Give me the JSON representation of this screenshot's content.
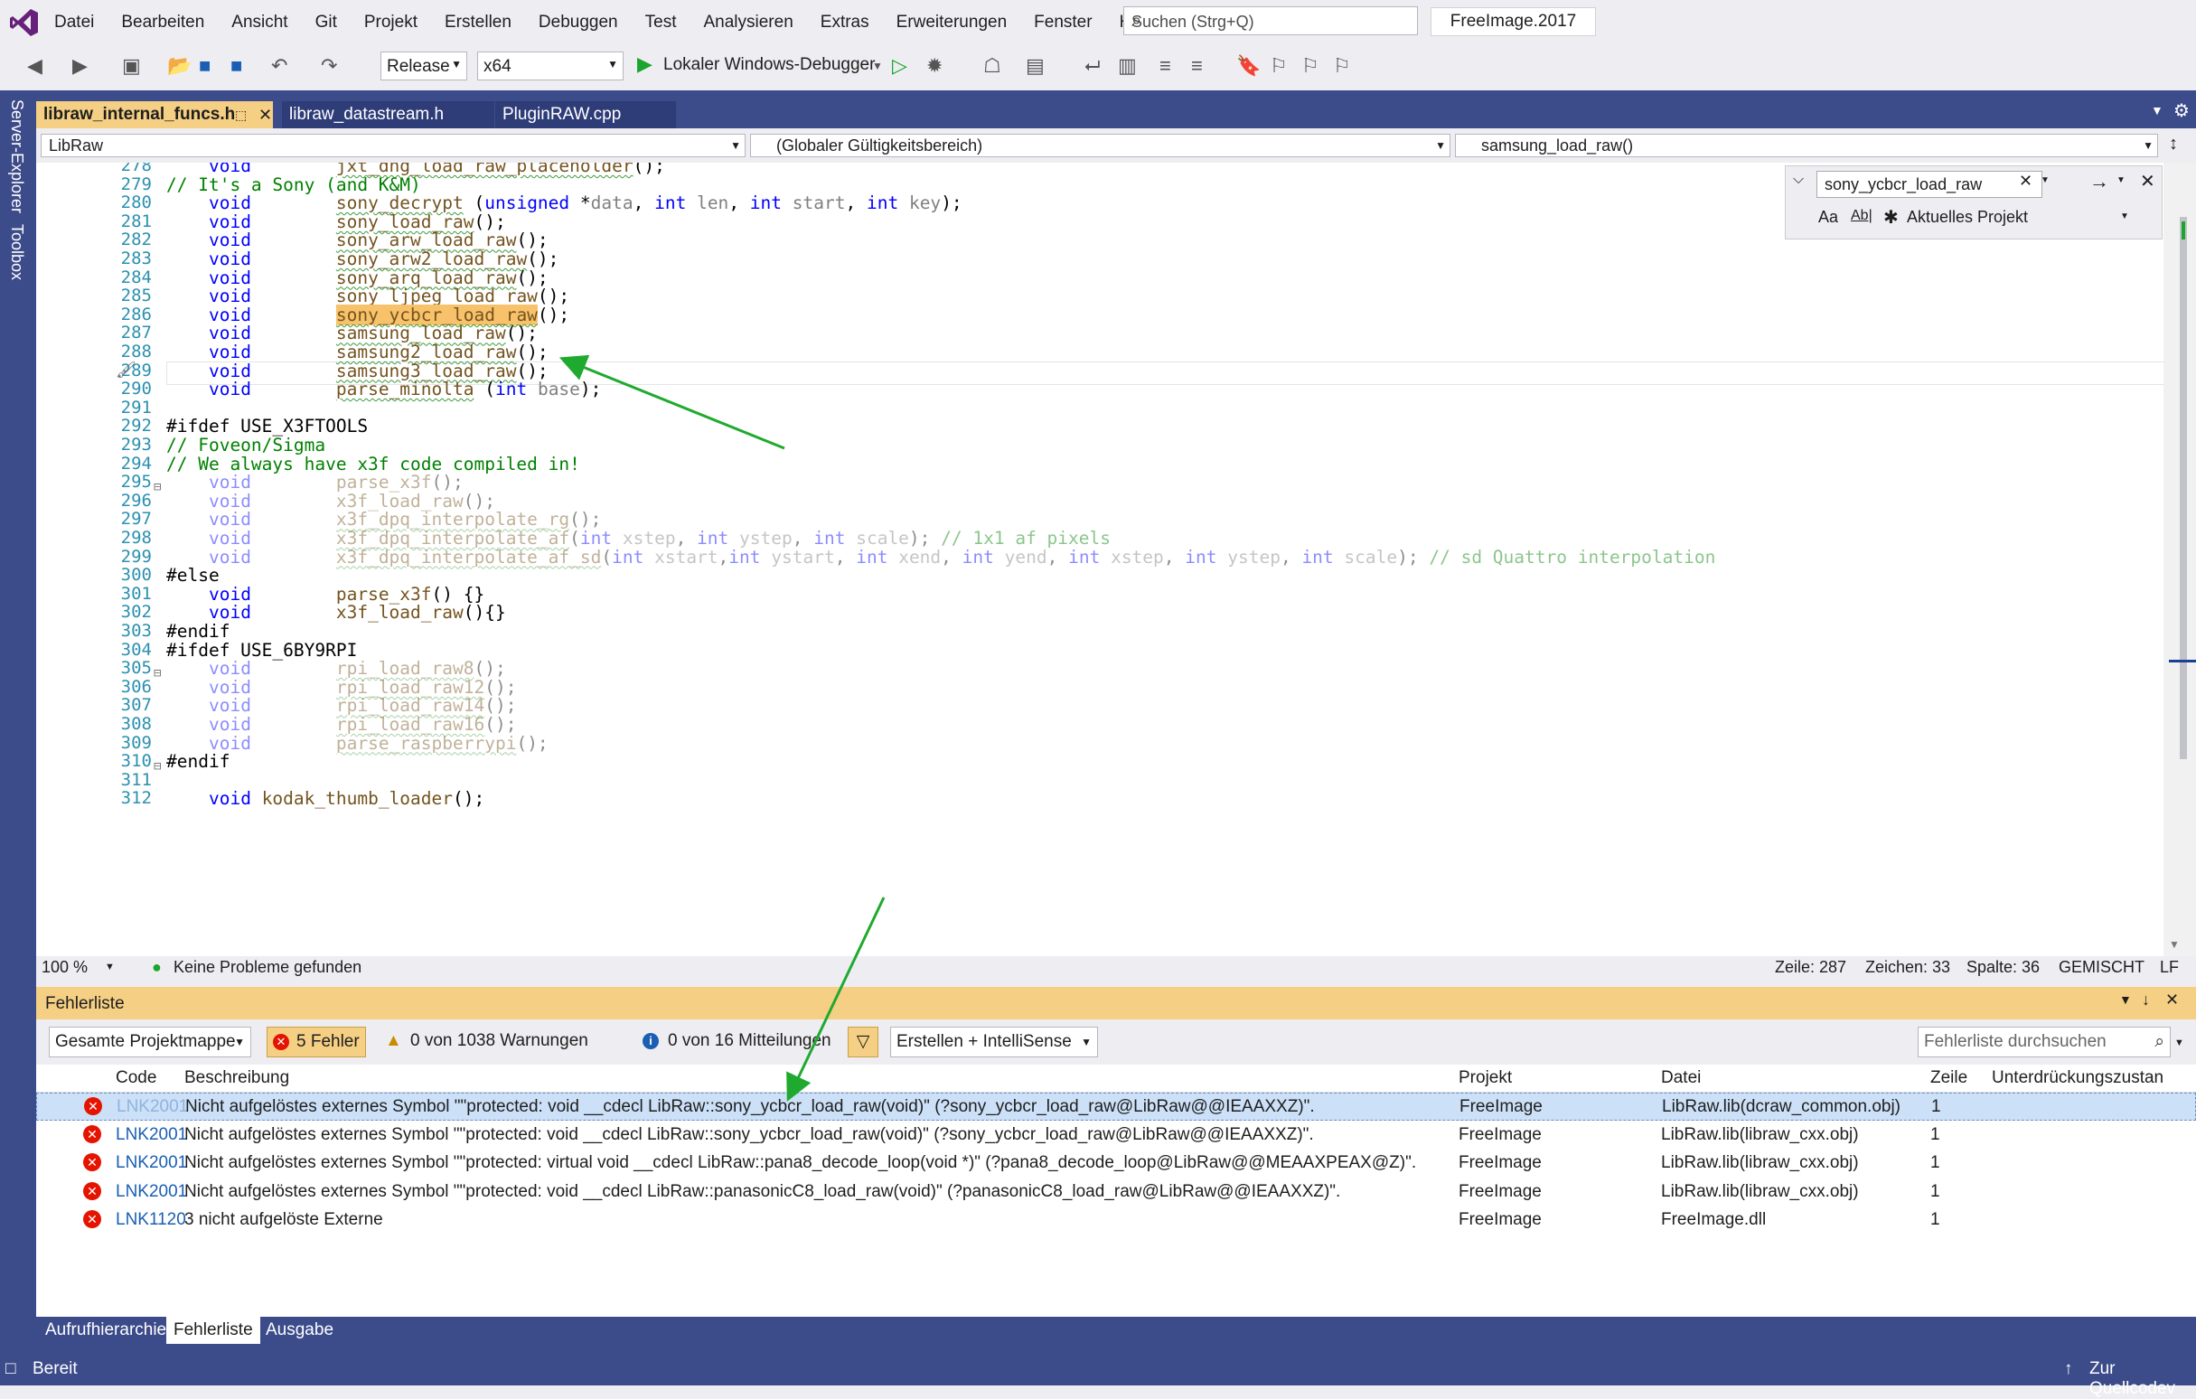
{
  "menu": {
    "items": [
      "Datei",
      "Bearbeiten",
      "Ansicht",
      "Git",
      "Projekt",
      "Erstellen",
      "Debuggen",
      "Test",
      "Analysieren",
      "Extras",
      "Erweiterungen",
      "Fenster",
      "Hilfe"
    ],
    "search_placeholder": "Suchen (Strg+Q)",
    "solution_name": "FreeImage.2017"
  },
  "toolbar": {
    "config": "Release",
    "platform": "x64",
    "debugger": "Lokaler Windows-Debugger"
  },
  "side_tools": [
    "Server-Explorer",
    "Toolbox"
  ],
  "tabs": [
    {
      "label": "libraw_internal_funcs.h",
      "active": true
    },
    {
      "label": "libraw_datastream.h",
      "active": false
    },
    {
      "label": "PluginRAW.cpp",
      "active": false
    }
  ],
  "nav": {
    "project": "LibRaw",
    "scope": "(Globaler Gültigkeitsbereich)",
    "member": "samsung_load_raw()"
  },
  "find": {
    "query": "sony_ycbcr_load_raw",
    "scope": "Aktuelles Projekt",
    "opt_case": "Aa",
    "opt_word": "Ab|"
  },
  "code_lines": [
    {
      "n": "278",
      "t": "    void        jxt_dng_load_raw_placeholder();"
    },
    {
      "n": "279",
      "t": "// It's a Sony (and K&M)"
    },
    {
      "n": "280",
      "t": "    void        sony_decrypt (unsigned *data, int len, int start, int key);"
    },
    {
      "n": "281",
      "t": "    void        sony_load_raw();"
    },
    {
      "n": "282",
      "t": "    void        sony_arw_load_raw();"
    },
    {
      "n": "283",
      "t": "    void        sony_arw2_load_raw();"
    },
    {
      "n": "284",
      "t": "    void        sony_arq_load_raw();"
    },
    {
      "n": "285",
      "t": "    void        sony_ljpeg_load_raw();"
    },
    {
      "n": "286",
      "t": "    void        sony_ycbcr_load_raw();"
    },
    {
      "n": "287",
      "t": "    void        samsung_load_raw();"
    },
    {
      "n": "288",
      "t": "    void        samsung2_load_raw();"
    },
    {
      "n": "289",
      "t": "    void        samsung3_load_raw();"
    },
    {
      "n": "290",
      "t": "    void        parse_minolta (int base);"
    },
    {
      "n": "291",
      "t": ""
    },
    {
      "n": "292",
      "t": "#ifdef USE_X3FTOOLS"
    },
    {
      "n": "293",
      "t": "// Foveon/Sigma"
    },
    {
      "n": "294",
      "t": "// We always have x3f code compiled in!"
    },
    {
      "n": "295",
      "t": "    void        parse_x3f();"
    },
    {
      "n": "296",
      "t": "    void        x3f_load_raw();"
    },
    {
      "n": "297",
      "t": "    void        x3f_dpq_interpolate_rg();"
    },
    {
      "n": "298",
      "t": "    void        x3f_dpq_interpolate_af(int xstep, int ystep, int scale); // 1x1 af pixels"
    },
    {
      "n": "299",
      "t": "    void        x3f_dpq_interpolate_af_sd(int xstart,int ystart, int xend, int yend, int xstep, int ystep, int scale); // sd Quattro interpolation"
    },
    {
      "n": "300",
      "t": "#else"
    },
    {
      "n": "301",
      "t": "    void        parse_x3f() {}"
    },
    {
      "n": "302",
      "t": "    void        x3f_load_raw(){}"
    },
    {
      "n": "303",
      "t": "#endif"
    },
    {
      "n": "304",
      "t": "#ifdef USE_6BY9RPI"
    },
    {
      "n": "305",
      "t": "    void        rpi_load_raw8();"
    },
    {
      "n": "306",
      "t": "    void        rpi_load_raw12();"
    },
    {
      "n": "307",
      "t": "    void        rpi_load_raw14();"
    },
    {
      "n": "308",
      "t": "    void        rpi_load_raw16();"
    },
    {
      "n": "309",
      "t": "    void        parse_raspberrypi();"
    },
    {
      "n": "310",
      "t": "#endif"
    },
    {
      "n": "311",
      "t": ""
    },
    {
      "n": "312",
      "t": "    void kodak_thumb_loader();"
    }
  ],
  "editor_status": {
    "zoom": "100 %",
    "issues": "Keine Probleme gefunden",
    "line": "Zeile: 287",
    "char": "Zeichen: 33",
    "col": "Spalte: 36",
    "mode": "GEMISCHT",
    "eol": "LF"
  },
  "errorlist": {
    "title": "Fehlerliste",
    "scope": "Gesamte Projektmappe",
    "errors": "5 Fehler",
    "warnings": "0 von 1038 Warnungen",
    "messages": "0 von 16 Mitteilungen",
    "build_filter": "Erstellen + IntelliSense",
    "search_placeholder": "Fehlerliste durchsuchen",
    "columns": [
      "Code",
      "Beschreibung",
      "Projekt",
      "Datei",
      "Zeile",
      "Unterdrückungszustan"
    ],
    "rows": [
      {
        "code": "LNK2001",
        "desc": "Nicht aufgelöstes externes Symbol \"\"protected: void __cdecl LibRaw::sony_ycbcr_load_raw(void)\" (?sony_ycbcr_load_raw@LibRaw@@IEAAXXZ)\".",
        "proj": "FreeImage",
        "file": "LibRaw.lib(dcraw_common.obj)",
        "line": "1"
      },
      {
        "code": "LNK2001",
        "desc": "Nicht aufgelöstes externes Symbol \"\"protected: void __cdecl LibRaw::sony_ycbcr_load_raw(void)\" (?sony_ycbcr_load_raw@LibRaw@@IEAAXXZ)\".",
        "proj": "FreeImage",
        "file": "LibRaw.lib(libraw_cxx.obj)",
        "line": "1"
      },
      {
        "code": "LNK2001",
        "desc": "Nicht aufgelöstes externes Symbol \"\"protected: virtual void __cdecl LibRaw::pana8_decode_loop(void *)\" (?pana8_decode_loop@LibRaw@@MEAAXPEAX@Z)\".",
        "proj": "FreeImage",
        "file": "LibRaw.lib(libraw_cxx.obj)",
        "line": "1"
      },
      {
        "code": "LNK2001",
        "desc": "Nicht aufgelöstes externes Symbol \"\"protected: void __cdecl LibRaw::panasonicC8_load_raw(void)\" (?panasonicC8_load_raw@LibRaw@@IEAAXXZ)\".",
        "proj": "FreeImage",
        "file": "LibRaw.lib(libraw_cxx.obj)",
        "line": "1"
      },
      {
        "code": "LNK1120",
        "desc": "3 nicht aufgelöste Externe",
        "proj": "FreeImage",
        "file": "FreeImage.dll",
        "line": "1"
      }
    ]
  },
  "bottom_tabs": [
    "Aufrufhierarchie",
    "Fehlerliste",
    "Ausgabe"
  ],
  "statusbar": {
    "left": "Bereit",
    "right": "Zur Quellcodev"
  },
  "colors": {
    "accent": "#3c4b8a",
    "tab_active": "#f5cf83",
    "error": "#e51400",
    "highlight": "#f7c26a",
    "arrow": "#1faa2f"
  }
}
